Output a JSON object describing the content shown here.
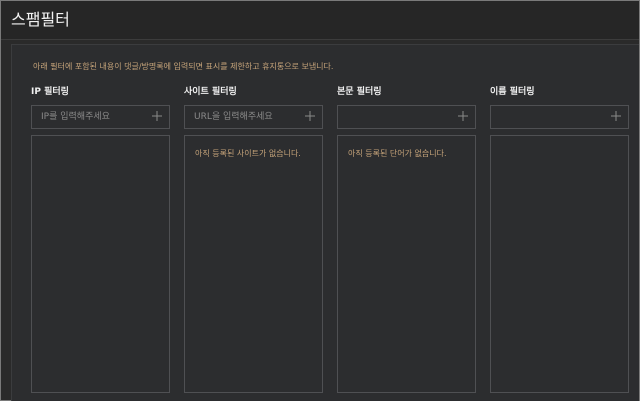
{
  "window": {
    "title": "스팸필터"
  },
  "panel": {
    "description": "아래 필터에 포함된 내용이 댓글/방명록에 입력되면 표시를 제한하고 휴지통으로 보냅니다."
  },
  "filters": [
    {
      "label": "IP 필터링",
      "placeholder": "IP를 입력해주세요",
      "add_icon": "plus-icon",
      "empty_message": ""
    },
    {
      "label": "사이트 필터링",
      "placeholder": "URL을 입력해주세요",
      "add_icon": "plus-icon",
      "empty_message": "아직 등록된 사이트가 없습니다."
    },
    {
      "label": "본문 필터링",
      "placeholder": "",
      "add_icon": "plus-icon",
      "empty_message": "아직 등록된 단어가 없습니다."
    },
    {
      "label": "이름 필터링",
      "placeholder": "",
      "add_icon": "plus-icon",
      "empty_message": ""
    }
  ],
  "colors": {
    "background": "#2a2a2a",
    "panel": "#2c2d2f",
    "border": "#4f5053",
    "accent_text": "#c6a47a",
    "title_text": "#f2f2f2"
  }
}
